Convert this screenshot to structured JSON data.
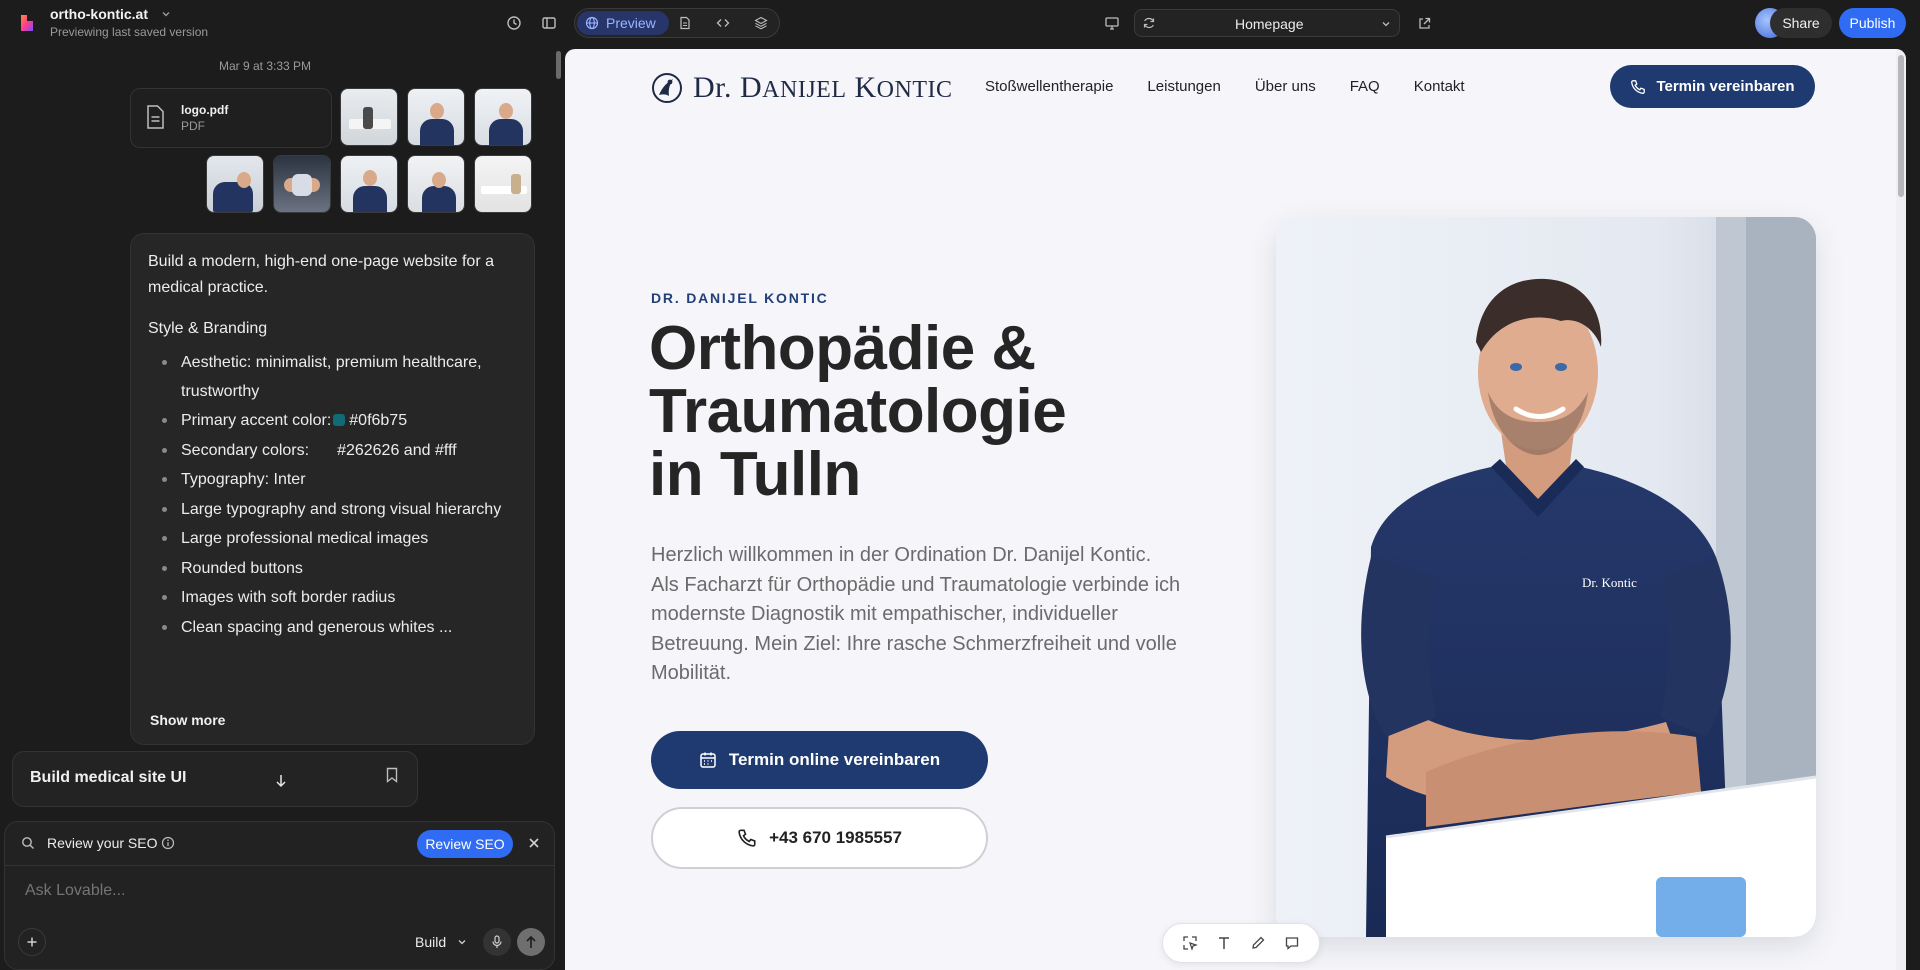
{
  "topbar": {
    "project_name": "ortho-kontic.at",
    "project_subtitle": "Previewing last saved version",
    "preview_label": "Preview",
    "route": "Homepage",
    "share_label": "Share",
    "publish_label": "Publish"
  },
  "chat": {
    "date": "Mar 9 at 3:33 PM",
    "attachment": {
      "name": "logo.pdf",
      "type": "PDF"
    },
    "message": {
      "intro": "Build a modern, high-end one-page website for a medical practice.",
      "section_title": "Style & Branding",
      "items": [
        "Aesthetic: minimalist, premium healthcare, trustworthy",
        "Primary accent color:",
        "Secondary colors:",
        "Typography: Inter",
        "Large typography and strong visual hierarchy",
        "Large professional medical images",
        "Rounded buttons",
        "Images with soft border radius",
        "Clean spacing and generous whites ..."
      ],
      "primary_color_value": "#0f6b75",
      "secondary_color_value": "#262626 and #fff",
      "show_more": "Show more"
    },
    "task_card_title": "Build medical site UI",
    "seo": {
      "text": "Review your SEO",
      "button": "Review SEO"
    },
    "composer": {
      "placeholder": "Ask Lovable...",
      "mode": "Build"
    }
  },
  "site": {
    "logo_prefix": "Dr.",
    "logo_first": "D",
    "logo_first_rest": "anijel",
    "logo_last": "K",
    "logo_last_rest": "ontic",
    "nav": [
      "Stoßwellentherapie",
      "Leistungen",
      "Über uns",
      "FAQ",
      "Kontakt"
    ],
    "nav_cta": "Termin vereinbaren",
    "eyebrow": "DR. DANIJEL KONTIC",
    "title_line1": "Orthopädie &",
    "title_line2": "Traumatologie",
    "title_line3": "in Tulln",
    "lead": "Herzlich willkommen in der Ordination Dr. Danijel Kontic. Als Facharzt für Orthopädie und Traumatologie verbinde ich modernste Diagnostik mit empathischer, individueller Betreuung. Mein Ziel: Ihre rasche Schmerzfreiheit und volle Mobilität.",
    "cta_primary": "Termin online vereinbaren",
    "cta_phone": "+43 670 1985557",
    "shirt_logo": "Dr. Kontic"
  },
  "colors": {
    "accent": "#2f6cf3",
    "site_navy": "#1e3a70",
    "chat_bg": "#1c1c1c",
    "swatch_primary": "#0f6b75"
  }
}
